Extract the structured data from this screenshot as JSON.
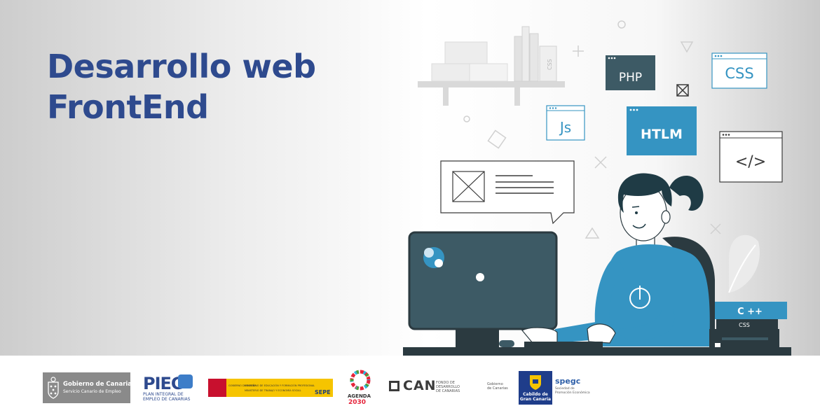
{
  "banner": {
    "title_line1": "Desarrollo web",
    "title_line2": "FrontEnd"
  },
  "illustration": {
    "tags": [
      "PHP",
      "CSS",
      "Js",
      "HTLM",
      "</>"
    ],
    "books": [
      "C ++",
      "CSS"
    ],
    "shelf_book": "CSS"
  },
  "footer": {
    "gobierno": {
      "line1": "Gobierno de Canarias",
      "line2": "Servicio Canario de Empleo"
    },
    "piec": {
      "big": "PIEC",
      "line1": "PLAN INTEGRAL DE",
      "line2": "EMPLEO DE CANARIAS"
    },
    "ministerios": {
      "gob": "GOBIERNO DE ESPAÑA",
      "m1": "MINISTERIO DE EDUCACIÓN Y FORMACIÓN PROFESIONAL",
      "m2": "MINISTERIO DE TRABAJO Y ECONOMÍA SOCIAL",
      "sepe": "SEPE"
    },
    "agenda": {
      "line1": "AGENDA",
      "line2": "2030"
    },
    "fdcan": {
      "can": "CAN",
      "line1": "FONDO DE",
      "line2": "DESARROLLO",
      "line3": "DE CANARIAS",
      "gob1": "Gobierno",
      "gob2": "de Canarias"
    },
    "cabildo": {
      "line1": "Cabildo de",
      "line2": "Gran Canaria"
    },
    "spegc": {
      "name": "spegc",
      "line1": "Sociedad de",
      "line2": "Promoción Económica"
    }
  },
  "colors": {
    "title": "#2e4a8e",
    "monitor": "#3d5a65",
    "sweater": "#3594c2",
    "tag_dark": "#3d5a65",
    "tag_blue": "#3594c2",
    "desk": "#2b3a40"
  }
}
